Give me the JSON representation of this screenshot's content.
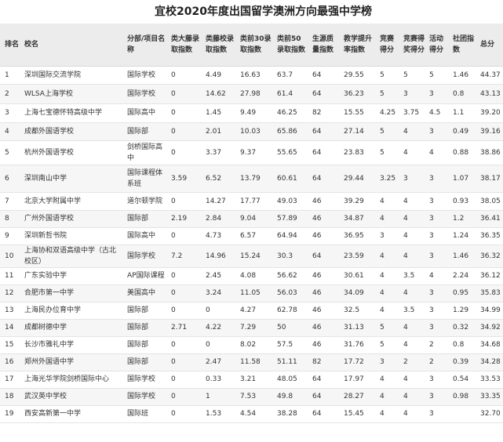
{
  "title": "宜校2020年度出国留学澳洲方向最强中学榜",
  "headers": [
    "排名",
    "校名",
    "分部/项目名称",
    "类大藤录取指数",
    "类藤校录取指数",
    "类前30录取指数",
    "类前50录取指数",
    "生源质量指数",
    "教学提升率指数",
    "竞赛得分",
    "竞赛得奖得分",
    "活动得分",
    "社团指数",
    "总分"
  ],
  "rows": [
    [
      "1",
      "深圳国际交流学院",
      "国际学校",
      "0",
      "4.49",
      "16.63",
      "63.7",
      "64",
      "29.55",
      "5",
      "5",
      "5",
      "1.46",
      "44.37"
    ],
    [
      "2",
      "WLSA上海学校",
      "国际学校",
      "0",
      "14.62",
      "27.98",
      "61.4",
      "64",
      "36.23",
      "5",
      "3",
      "3",
      "0.8",
      "43.13"
    ],
    [
      "3",
      "上海七宝德怀特高级中学",
      "国际高中",
      "0",
      "1.45",
      "9.49",
      "46.25",
      "82",
      "15.55",
      "4.25",
      "3.75",
      "4.5",
      "1.1",
      "39.20"
    ],
    [
      "4",
      "成都外国语学校",
      "国际部",
      "0",
      "2.01",
      "10.03",
      "65.86",
      "64",
      "27.14",
      "5",
      "4",
      "3",
      "0.49",
      "39.16"
    ],
    [
      "5",
      "杭州外国语学校",
      "剑桥国际高中",
      "0",
      "3.37",
      "9.37",
      "55.65",
      "64",
      "23.83",
      "5",
      "4",
      "4",
      "0.88",
      "38.86"
    ],
    [
      "6",
      "深圳南山中学",
      "国际课程体系班",
      "3.59",
      "6.52",
      "13.79",
      "60.61",
      "64",
      "29.44",
      "3.25",
      "3",
      "3",
      "1.07",
      "38.17"
    ],
    [
      "7",
      "北京大学附属中学",
      "道尔顿学院",
      "0",
      "14.27",
      "17.77",
      "49.03",
      "46",
      "39.29",
      "4",
      "4",
      "3",
      "0.93",
      "38.05"
    ],
    [
      "8",
      "广州外国语学校",
      "国际部",
      "2.19",
      "2.84",
      "9.04",
      "57.89",
      "46",
      "34.87",
      "4",
      "4",
      "3",
      "1.2",
      "36.41"
    ],
    [
      "9",
      "深圳新哲书院",
      "国际高中",
      "0",
      "4.73",
      "6.57",
      "64.94",
      "46",
      "36.95",
      "3",
      "4",
      "3",
      "1.24",
      "36.35"
    ],
    [
      "10",
      "上海协和双语高级中学（古北校区）",
      "国际学校",
      "7.2",
      "14.96",
      "15.24",
      "30.3",
      "64",
      "23.59",
      "4",
      "4",
      "3",
      "1.46",
      "36.32"
    ],
    [
      "11",
      "广东实验中学",
      "AP国际课程",
      "0",
      "2.45",
      "4.08",
      "56.62",
      "46",
      "30.61",
      "4",
      "3.5",
      "4",
      "2.24",
      "36.12"
    ],
    [
      "12",
      "合肥市第一中学",
      "美国高中",
      "0",
      "3.24",
      "11.05",
      "56.03",
      "46",
      "34.09",
      "4",
      "4",
      "3",
      "0.95",
      "35.83"
    ],
    [
      "13",
      "上海民办位育中学",
      "国际部",
      "0",
      "0",
      "4.27",
      "62.78",
      "46",
      "32.5",
      "4",
      "3.5",
      "3",
      "1.29",
      "34.99"
    ],
    [
      "14",
      "成都树德中学",
      "国际部",
      "2.71",
      "4.22",
      "7.29",
      "50",
      "46",
      "31.13",
      "5",
      "4",
      "3",
      "0.32",
      "34.92"
    ],
    [
      "15",
      "长沙市雅礼中学",
      "国际部",
      "0",
      "0",
      "8.02",
      "57.5",
      "46",
      "31.76",
      "5",
      "4",
      "2",
      "0.8",
      "34.68"
    ],
    [
      "16",
      "郑州外国语中学",
      "国际部",
      "0",
      "2.47",
      "11.58",
      "51.11",
      "82",
      "17.72",
      "3",
      "2",
      "2",
      "0.39",
      "34.28"
    ],
    [
      "17",
      "上海光华学院剑桥国际中心",
      "国际学校",
      "0",
      "0.33",
      "3.21",
      "48.05",
      "64",
      "17.97",
      "4",
      "4",
      "3",
      "0.54",
      "33.53"
    ],
    [
      "18",
      "武汉英中学校",
      "国际学校",
      "0",
      "1",
      "7.53",
      "49.8",
      "64",
      "28.27",
      "4",
      "4",
      "3",
      "0.98",
      "33.35"
    ],
    [
      "19",
      "西安高新第一中学",
      "国际班",
      "0",
      "1.53",
      "4.54",
      "38.28",
      "64",
      "15.45",
      "4",
      "4",
      "3",
      "",
      "32.70"
    ]
  ]
}
